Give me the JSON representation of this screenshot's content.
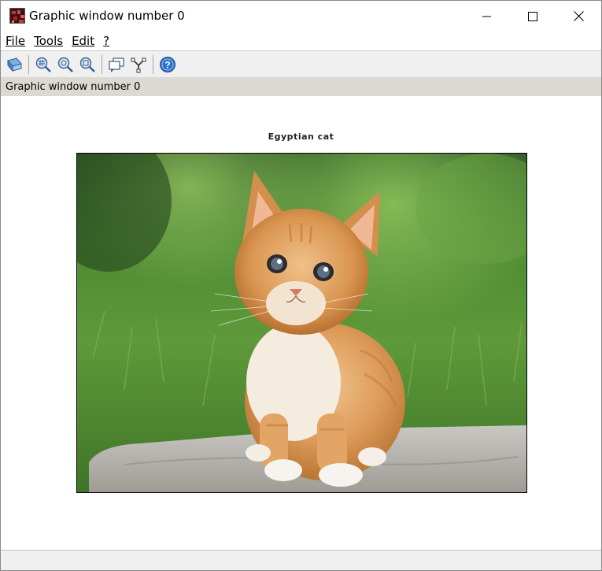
{
  "window": {
    "title": "Graphic window number 0"
  },
  "menu": {
    "file": "File",
    "tools": "Tools",
    "edit": "Edit",
    "help": "?"
  },
  "toolbar": {
    "icons": [
      "rotate-icon",
      "zoom-region-icon",
      "zoom-original-icon",
      "zoom-icon",
      "figure-window-icon",
      "datatip-icon",
      "help-icon"
    ]
  },
  "infobar": {
    "text": "Graphic window number 0"
  },
  "figure": {
    "title": "Egyptian cat"
  },
  "colors": {
    "toolbar_bg": "#f0f0f0",
    "infobar_bg": "#dcd8d2",
    "help_blue": "#2f6fc6"
  }
}
